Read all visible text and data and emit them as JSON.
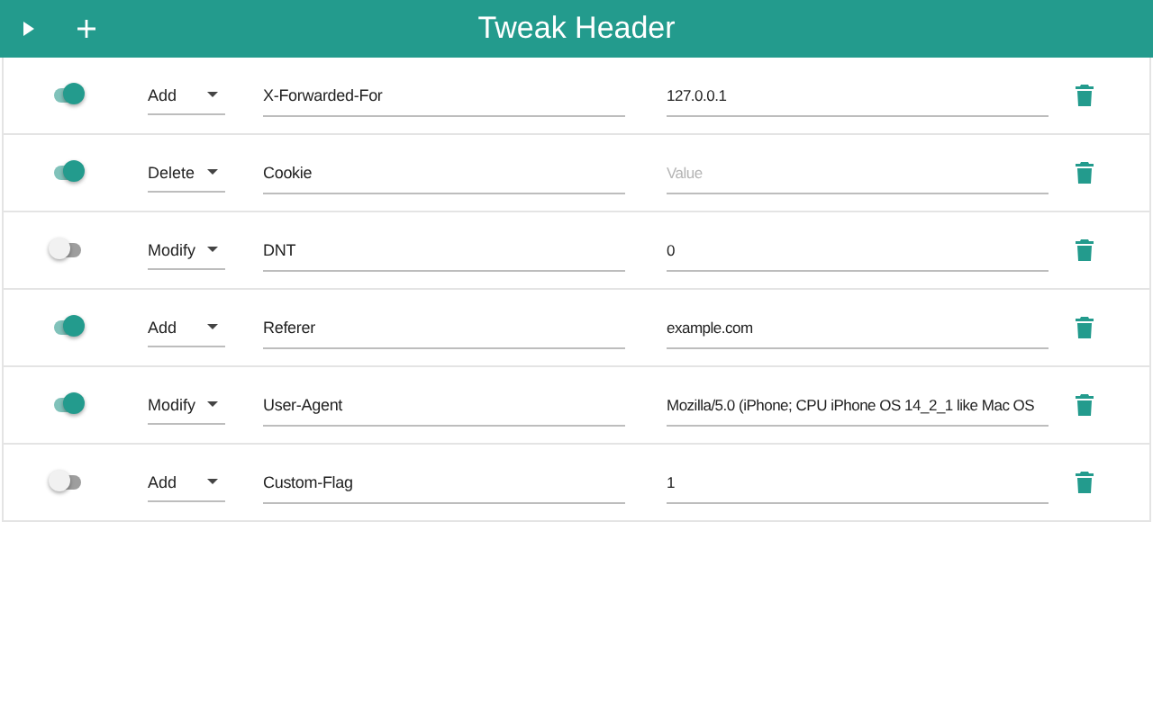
{
  "header": {
    "title": "Tweak Header"
  },
  "rows": [
    {
      "on": true,
      "action": "Add",
      "name": "X-Forwarded-For",
      "value": "127.0.0.1"
    },
    {
      "on": true,
      "action": "Delete",
      "name": "Cookie",
      "placeholder": "Value"
    },
    {
      "on": false,
      "action": "Modify",
      "name": "DNT",
      "value": "0"
    },
    {
      "on": true,
      "action": "Add",
      "name": "Referer",
      "value": "example.com"
    },
    {
      "on": true,
      "action": "Modify",
      "name": "User-Agent",
      "value": "Mozilla/5.0 (iPhone; CPU iPhone OS 14_2_1 like Mac OS"
    },
    {
      "on": false,
      "action": "Add",
      "name": "Custom-Flag",
      "value": "1"
    }
  ]
}
